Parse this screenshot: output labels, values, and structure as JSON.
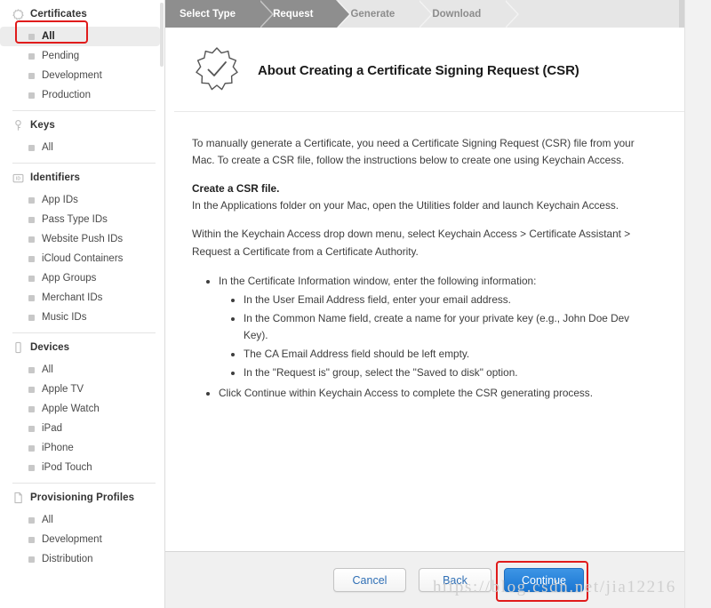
{
  "sidebar": {
    "groups": [
      {
        "title": "Certificates",
        "icon": "certificate-seal-icon",
        "items": [
          {
            "label": "All",
            "selected": true
          },
          {
            "label": "Pending",
            "selected": false
          },
          {
            "label": "Development",
            "selected": false
          },
          {
            "label": "Production",
            "selected": false
          }
        ]
      },
      {
        "title": "Keys",
        "icon": "key-icon",
        "items": [
          {
            "label": "All",
            "selected": false
          }
        ]
      },
      {
        "title": "Identifiers",
        "icon": "id-badge-icon",
        "items": [
          {
            "label": "App IDs",
            "selected": false
          },
          {
            "label": "Pass Type IDs",
            "selected": false
          },
          {
            "label": "Website Push IDs",
            "selected": false
          },
          {
            "label": "iCloud Containers",
            "selected": false
          },
          {
            "label": "App Groups",
            "selected": false
          },
          {
            "label": "Merchant IDs",
            "selected": false
          },
          {
            "label": "Music IDs",
            "selected": false
          }
        ]
      },
      {
        "title": "Devices",
        "icon": "device-phone-icon",
        "items": [
          {
            "label": "All",
            "selected": false
          },
          {
            "label": "Apple TV",
            "selected": false
          },
          {
            "label": "Apple Watch",
            "selected": false
          },
          {
            "label": "iPad",
            "selected": false
          },
          {
            "label": "iPhone",
            "selected": false
          },
          {
            "label": "iPod Touch",
            "selected": false
          }
        ]
      },
      {
        "title": "Provisioning Profiles",
        "icon": "document-icon",
        "items": [
          {
            "label": "All",
            "selected": false
          },
          {
            "label": "Development",
            "selected": false
          },
          {
            "label": "Distribution",
            "selected": false
          }
        ]
      }
    ]
  },
  "steps": [
    {
      "label": "Select Type",
      "state": "done"
    },
    {
      "label": "Request",
      "state": "current"
    },
    {
      "label": "Generate",
      "state": "pending"
    },
    {
      "label": "Download",
      "state": "pending"
    }
  ],
  "page": {
    "icon": "certificate-seal-check-icon",
    "title": "About Creating a Certificate Signing Request (CSR)",
    "intro": "To manually generate a Certificate, you need a Certificate Signing Request (CSR) file from your Mac. To create a CSR file, follow the instructions below to create one using Keychain Access.",
    "section_heading": "Create a CSR file.",
    "section_line": "In the Applications folder on your Mac, open the Utilities folder and launch Keychain Access.",
    "paragraph_2": "Within the Keychain Access drop down menu, select Keychain Access > Certificate Assistant > Request a Certificate from a Certificate Authority.",
    "bullets": [
      {
        "text": "In the Certificate Information window, enter the following information:",
        "sub": [
          "In the User Email Address field, enter your email address.",
          "In the Common Name field, create a name for your private key (e.g., John Doe Dev Key).",
          "The CA Email Address field should be left empty.",
          "In the \"Request is\" group, select the \"Saved to disk\" option."
        ]
      },
      {
        "text": "Click Continue within Keychain Access to complete the CSR generating process.",
        "sub": []
      }
    ]
  },
  "footer": {
    "cancel_label": "Cancel",
    "back_label": "Back",
    "continue_label": "Continue"
  },
  "watermark": {
    "text": "https://blog.csdn.net/jia12216"
  },
  "colors": {
    "accent_blue": "#1a76d2",
    "annotation_red": "#e01b1b",
    "step_active": "#8e8e8e",
    "step_inactive": "#e6e6e6",
    "selected_row": "#ececec"
  }
}
